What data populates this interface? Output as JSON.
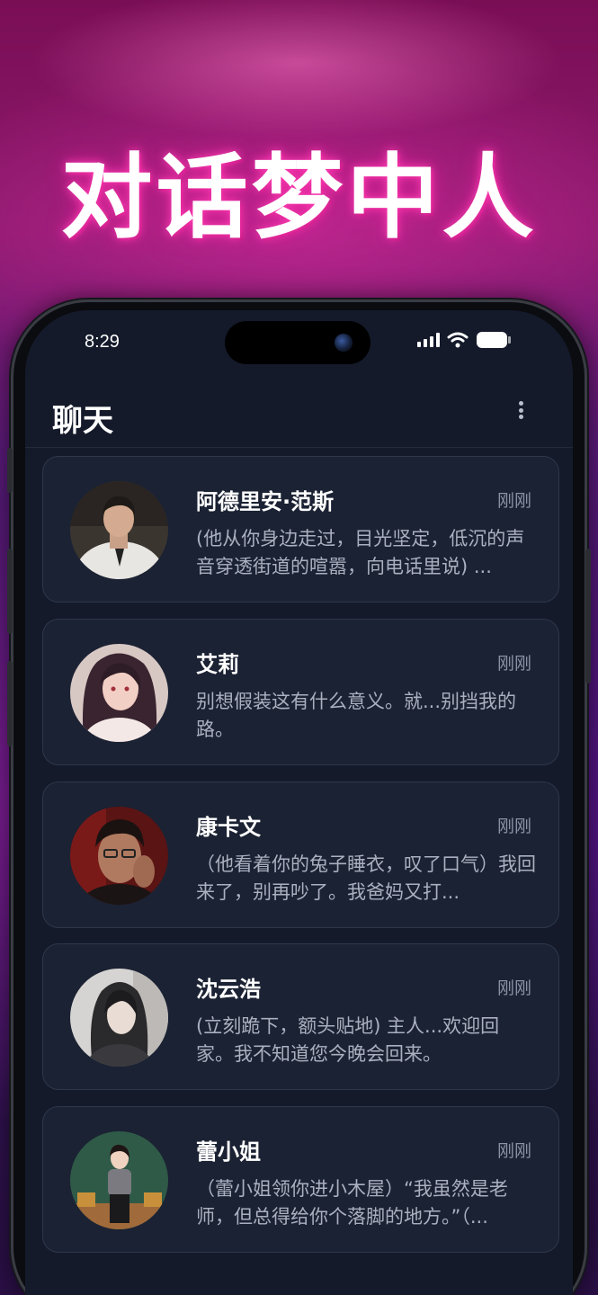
{
  "banner": {
    "title": "对话梦中人"
  },
  "status_bar": {
    "time": "8:29"
  },
  "header": {
    "title": "聊天"
  },
  "chats": [
    {
      "name": "阿德里安·范斯",
      "time": "刚刚",
      "preview": "(他从你身边走过，目光坚定，低沉的声音穿透街道的喧嚣，向电话里说) ..."
    },
    {
      "name": "艾莉",
      "time": "刚刚",
      "preview": "别想假装这有什么意义。就...别挡我的路。"
    },
    {
      "name": "康卡文",
      "time": "刚刚",
      "preview": "（他看着你的兔子睡衣，叹了口气）我回来了，别再吵了。我爸妈又打..."
    },
    {
      "name": "沈云浩",
      "time": "刚刚",
      "preview": "(立刻跪下，额头贴地) 主人...欢迎回家。我不知道您今晚会回来。"
    },
    {
      "name": "蕾小姐",
      "time": "刚刚",
      "preview": "（蕾小姐领你进小木屋）“我虽然是老师，但总得给你个落脚的地方。”（..."
    }
  ],
  "colors": {
    "screen_bg": "#141a2a",
    "card_bg": "#1b2233",
    "title_glow": "#ff3fb4"
  },
  "icons": [
    "signal-icon",
    "wifi-icon",
    "battery-icon",
    "more-vertical-icon",
    "camera-icon"
  ]
}
